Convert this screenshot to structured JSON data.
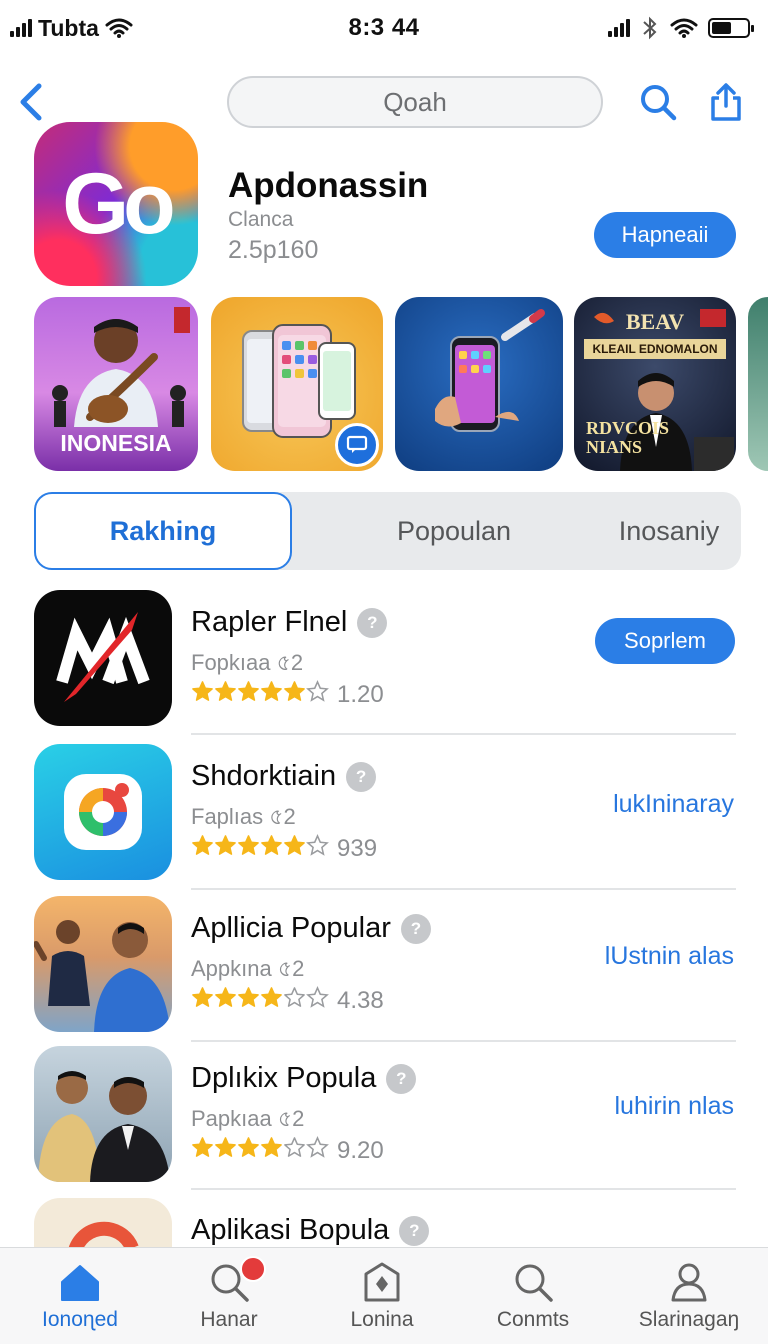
{
  "status_bar": {
    "carrier": "Tubta",
    "time": "8:3 44"
  },
  "nav": {
    "search_placeholder": "Qoah"
  },
  "featured": {
    "icon_text": "Go",
    "title": "Apdonassin",
    "subtitle": "Clanca",
    "size": "2.5p160",
    "button_label": "Hapneaii"
  },
  "screenshots": {
    "shot1_caption": "INONESIA",
    "shot4_heading": "BEAV",
    "shot4_banner": "KLEAIL EDNOMALON",
    "shot4_footer_line1": "RDVCOIS",
    "shot4_footer_line2": "NIANS"
  },
  "segments": [
    "Rakhing",
    "Popoulan",
    "Inosaniy"
  ],
  "apps": [
    {
      "name": "Rapler Flnel",
      "sub": "Fopkıaa ৫2",
      "stars": 5,
      "rating": "1.20",
      "action": "Soprlem",
      "action_type": "button"
    },
    {
      "name": "Shdorktiain",
      "sub": "Faplıas ৫2",
      "stars": 5,
      "rating": "939",
      "action": "lukIninaray",
      "action_type": "link"
    },
    {
      "name": "Apllicia Popular",
      "sub": "Appkına ৫2",
      "stars": 4,
      "rating": "4.38",
      "action": "lUstnin alas",
      "action_type": "link"
    },
    {
      "name": "Dplıkix Popula",
      "sub": "Papkıaa ৫2",
      "stars": 4,
      "rating": "9.20",
      "action": "luhirin nlas",
      "action_type": "link"
    },
    {
      "name": "Aplikasi Bopula",
      "sub": "",
      "stars": 0,
      "rating": "",
      "action": "",
      "action_type": "none"
    }
  ],
  "tabs": [
    "Ionoɳed",
    "Hanar",
    "Lonina",
    "Conmts",
    "Slarinagaŋ"
  ],
  "colors": {
    "accent": "#2b7ee6",
    "star": "#f6b619",
    "badge": "#e33b3b"
  },
  "icons": {
    "back": "chevron-left-icon",
    "search": "search-icon",
    "share": "share-icon",
    "home": "home-icon",
    "tab_search": "search-icon",
    "apps": "apps-icon",
    "profile": "person-icon"
  }
}
